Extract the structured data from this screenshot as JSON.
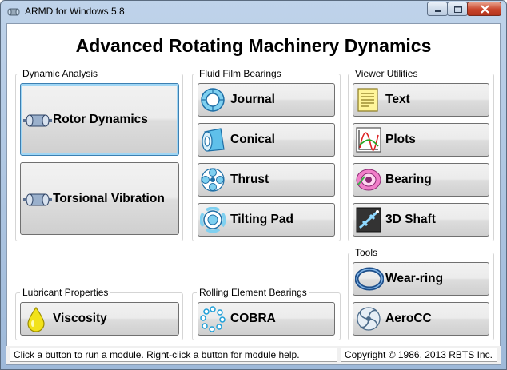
{
  "window": {
    "title": "ARMD for Windows 5.8"
  },
  "app": {
    "heading": "Advanced Rotating Machinery Dynamics"
  },
  "groups": {
    "dynamic": "Dynamic Analysis",
    "fluid": "Fluid Film Bearings",
    "viewer": "Viewer Utilities",
    "tools": "Tools",
    "lubricant": "Lubricant Properties",
    "rolling": "Rolling Element Bearings"
  },
  "buttons": {
    "rotor": "Rotor Dynamics",
    "torsional": "Torsional Vibration",
    "journal": "Journal",
    "conical": "Conical",
    "thrust": "Thrust",
    "tilting": "Tilting Pad",
    "text": "Text",
    "plots": "Plots",
    "bearing": "Bearing",
    "shaft": "3D Shaft",
    "wearring": "Wear-ring",
    "aerocc": "AeroCC",
    "viscosity": "Viscosity",
    "cobra": "COBRA"
  },
  "status": {
    "hint": "Click a button to run a module. Right-click a button for module help.",
    "copyright": "Copyright © 1986, 2013 RBTS Inc."
  },
  "icons": [
    "rotor-icon",
    "journal-icon",
    "conical-icon",
    "thrust-icon",
    "tilting-pad-icon",
    "text-icon",
    "plots-icon",
    "bearing-icon",
    "shaft-3d-icon",
    "wear-ring-icon",
    "aerocc-icon",
    "viscosity-icon",
    "cobra-icon"
  ]
}
